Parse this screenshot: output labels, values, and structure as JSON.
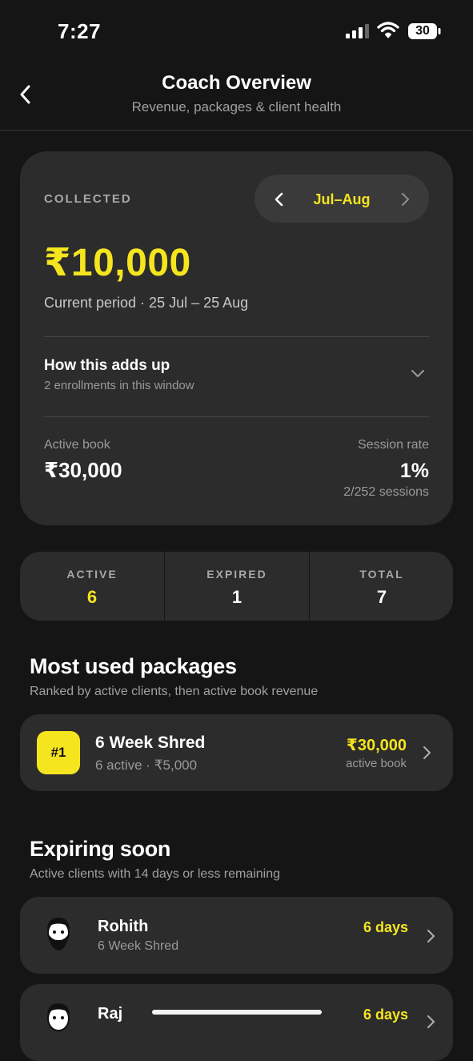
{
  "status_bar": {
    "time": "7:27",
    "battery": "30"
  },
  "header": {
    "title": "Coach Overview",
    "subtitle": "Revenue, packages & client health"
  },
  "collected_card": {
    "label": "COLLECTED",
    "period": "Jul–Aug",
    "amount": "₹10,000",
    "current_period": "Current period · 25 Jul – 25 Aug",
    "breakdown_title": "How this adds up",
    "breakdown_sub": "2 enrollments in this window",
    "active_book_label": "Active book",
    "active_book_value": "₹30,000",
    "session_rate_label": "Session rate",
    "session_rate_value": "1%",
    "session_rate_detail": "2/252 sessions"
  },
  "stats": [
    {
      "label": "ACTIVE",
      "value": "6",
      "color": "#f5e51f"
    },
    {
      "label": "EXPIRED",
      "value": "1",
      "color": "#ffffff"
    },
    {
      "label": "TOTAL",
      "value": "7",
      "color": "#ffffff"
    }
  ],
  "packages_section": {
    "title": "Most used packages",
    "subtitle": "Ranked by active clients, then active book revenue",
    "items": [
      {
        "rank": "#1",
        "name": "6 Week Shred",
        "meta": "6 active · ₹5,000",
        "value": "₹30,000",
        "caption": "active book"
      }
    ]
  },
  "expiring_section": {
    "title": "Expiring soon",
    "subtitle": "Active clients with 14 days or less remaining",
    "clients": [
      {
        "name": "Rohith",
        "package": "6 Week Shred",
        "days": "6 days"
      },
      {
        "name": "Raj",
        "days": "6 days"
      }
    ]
  },
  "colors": {
    "accent": "#f5e51f",
    "card": "#2c2c2d",
    "background": "#151515"
  }
}
